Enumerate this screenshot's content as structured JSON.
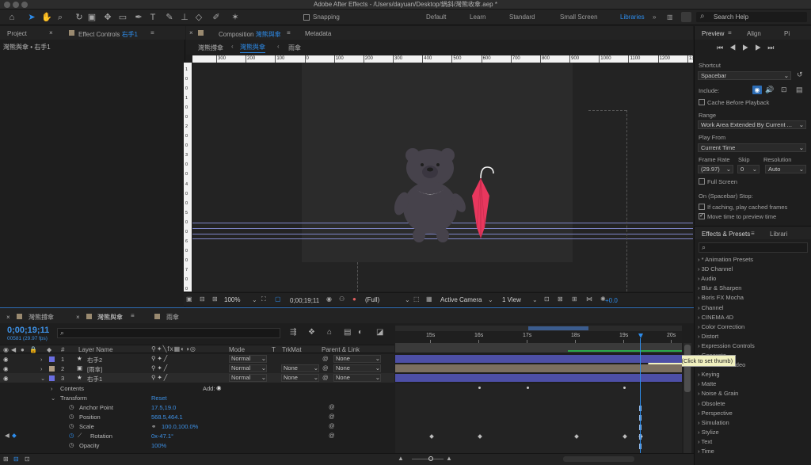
{
  "title": "Adobe After Effects - /Users/dayuan/Desktop/鍋斜/灣熊收傘.aep *",
  "toolbar": {
    "snapping_label": "Snapping",
    "workspaces": [
      "Default",
      "Learn",
      "Standard",
      "Small Screen",
      "Libraries"
    ],
    "search_placeholder": "Search Help"
  },
  "left_panel": {
    "project_tab": "Project",
    "effect_controls_tab_prefix": "Effect Controls",
    "effect_controls_layer": "右手1",
    "breadcrumb": "灣熊與傘 • 右手1"
  },
  "composition": {
    "tab_prefix": "Composition",
    "tab_name": "灣熊與傘",
    "metadata_tab": "Metadata",
    "crumbs": [
      "灣熊撐傘",
      "灣熊與傘",
      "雨傘"
    ],
    "ruler_ticks": [
      "300",
      "200",
      "100",
      "0",
      "100",
      "200",
      "300",
      "400",
      "500",
      "600",
      "700",
      "800",
      "900",
      "1000",
      "1100",
      "1200",
      "1300"
    ],
    "vruler_ticks": [
      "1",
      "0",
      "0",
      "1",
      "0",
      "0",
      "2",
      "0",
      "0",
      "3",
      "0",
      "0",
      "4",
      "0",
      "0",
      "5",
      "0",
      "0",
      "6",
      "0",
      "0",
      "7",
      "0",
      "0"
    ],
    "footer": {
      "zoom": "100%",
      "timecode": "0;00;19;11",
      "resolution": "(Full)",
      "camera": "Active Camera",
      "views": "1 View",
      "exposure": "+0.0"
    }
  },
  "preview": {
    "tab": "Preview",
    "align_tab": "Align",
    "p_tab": "Pi",
    "shortcut_label": "Shortcut",
    "shortcut_value": "Spacebar",
    "include_label": "Include:",
    "cache_label": "Cache Before Playback",
    "range_label": "Range",
    "range_value": "Work Area Extended By Current ...",
    "play_from_label": "Play From",
    "play_from_value": "Current Time",
    "frame_rate_label": "Frame Rate",
    "skip_label": "Skip",
    "resolution_label": "Resolution",
    "frame_rate_value": "(29.97)",
    "skip_value": "0",
    "resolution_value": "Auto",
    "fullscreen_label": "Full Screen",
    "on_stop_label": "On (Spacebar) Stop:",
    "if_caching_label": "If caching, play cached frames",
    "move_time_label": "Move time to preview time"
  },
  "effects": {
    "tab": "Effects & Presets",
    "libraries_tab": "Librari",
    "items": [
      "* Animation Presets",
      "3D Channel",
      "Audio",
      "Blur & Sharpen",
      "Boris FX Mocha",
      "Channel",
      "CINEMA 4D",
      "Color Correction",
      "Distort",
      "Expression Controls",
      "Generate",
      "Immersive Video",
      "Keying",
      "Matte",
      "Noise & Grain",
      "Obsolete",
      "Perspective",
      "Simulation",
      "Stylize",
      "Text",
      "Time"
    ]
  },
  "timeline": {
    "tabs": [
      "灣熊撐傘",
      "灣熊與傘",
      "雨傘"
    ],
    "timecode": "0;00;19;11",
    "fps": "00581 (29.97 fps)",
    "col_hash": "#",
    "col_layer_name": "Layer Name",
    "col_mode": "Mode",
    "col_t": "T",
    "col_trkmat": "TrkMat",
    "col_parent": "Parent & Link",
    "time_labels": [
      "15s",
      "16s",
      "17s",
      "18s",
      "19s",
      "20s"
    ],
    "tooltip": "Time Ruler (Click to set thumb)",
    "layers": [
      {
        "num": "1",
        "name": "右手2",
        "mode": "Normal",
        "trkmat": "",
        "parent": "None",
        "color": "#6b6ee0"
      },
      {
        "num": "2",
        "name": "[雨傘]",
        "mode": "Normal",
        "trkmat": "None",
        "parent": "None",
        "color": "#b09c82"
      },
      {
        "num": "3",
        "name": "右手1",
        "mode": "Normal",
        "trkmat": "None",
        "parent": "None",
        "color": "#6b6ee0"
      }
    ],
    "contents_label": "Contents",
    "add_label": "Add:",
    "transform_label": "Transform",
    "reset_label": "Reset",
    "props": [
      {
        "name": "Anchor Point",
        "value": "17.5,19.0"
      },
      {
        "name": "Position",
        "value": "568.5,464.1"
      },
      {
        "name": "Scale",
        "value": "100.0,100.0%"
      },
      {
        "name": "Rotation",
        "value": "0x-47.1°"
      },
      {
        "name": "Opacity",
        "value": "100%"
      }
    ]
  }
}
